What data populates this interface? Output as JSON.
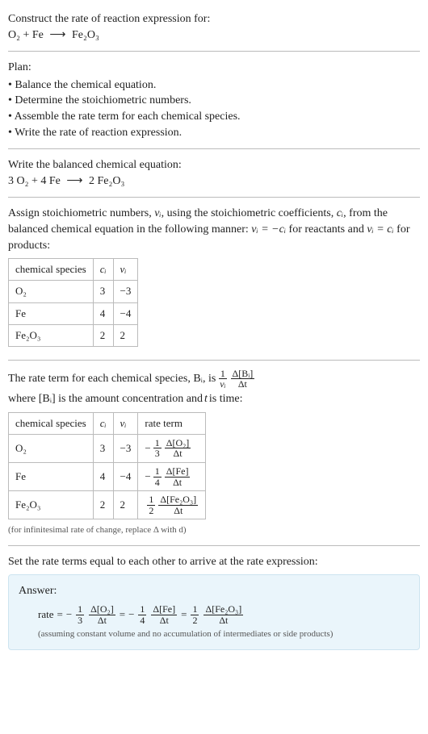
{
  "header": {
    "prompt": "Construct the rate of reaction expression for:",
    "equation_lhs": "O₂ + Fe",
    "equation_rhs": "Fe₂O₃"
  },
  "plan": {
    "title": "Plan:",
    "items": [
      "Balance the chemical equation.",
      "Determine the stoichiometric numbers.",
      "Assemble the rate term for each chemical species.",
      "Write the rate of reaction expression."
    ]
  },
  "balanced": {
    "title": "Write the balanced chemical equation:",
    "lhs": "3 O₂ + 4 Fe",
    "rhs": "2 Fe₂O₃"
  },
  "stoich": {
    "intro_a": "Assign stoichiometric numbers, ",
    "nu_i": "νᵢ",
    "intro_b": ", using the stoichiometric coefficients, ",
    "c_i": "cᵢ",
    "intro_c": ", from the balanced chemical equation in the following manner: ",
    "rel_reactants": "νᵢ = −cᵢ",
    "intro_d": " for reactants and ",
    "rel_products": "νᵢ = cᵢ",
    "intro_e": " for products:",
    "headers": {
      "species": "chemical species",
      "ci": "cᵢ",
      "nui": "νᵢ"
    },
    "rows": [
      {
        "species": "O₂",
        "ci": "3",
        "nui": "−3"
      },
      {
        "species": "Fe",
        "ci": "4",
        "nui": "−4"
      },
      {
        "species": "Fe₂O₃",
        "ci": "2",
        "nui": "2"
      }
    ]
  },
  "rateterm": {
    "intro_a": "The rate term for each chemical species, Bᵢ, is ",
    "frac1_num": "1",
    "frac1_den": "νᵢ",
    "frac2_num": "Δ[Bᵢ]",
    "frac2_den": "Δt",
    "intro_b": " where [Bᵢ] is the amount concentration and ",
    "t": "t",
    "intro_c": " is time:",
    "headers": {
      "species": "chemical species",
      "ci": "cᵢ",
      "nui": "νᵢ",
      "rate": "rate term"
    },
    "rows": [
      {
        "species": "O₂",
        "ci": "3",
        "nui": "−3",
        "sign": "−",
        "coef_num": "1",
        "coef_den": "3",
        "d_num": "Δ[O₂]",
        "d_den": "Δt"
      },
      {
        "species": "Fe",
        "ci": "4",
        "nui": "−4",
        "sign": "−",
        "coef_num": "1",
        "coef_den": "4",
        "d_num": "Δ[Fe]",
        "d_den": "Δt"
      },
      {
        "species": "Fe₂O₃",
        "ci": "2",
        "nui": "2",
        "sign": "",
        "coef_num": "1",
        "coef_den": "2",
        "d_num": "Δ[Fe₂O₃]",
        "d_den": "Δt"
      }
    ],
    "note": "(for infinitesimal rate of change, replace Δ with d)"
  },
  "final": {
    "title": "Set the rate terms equal to each other to arrive at the rate expression:"
  },
  "answer": {
    "label": "Answer:",
    "rate_word": "rate",
    "eq": "=",
    "minus": "−",
    "t1": {
      "cnum": "1",
      "cden": "3",
      "dnum": "Δ[O₂]",
      "dden": "Δt"
    },
    "t2": {
      "cnum": "1",
      "cden": "4",
      "dnum": "Δ[Fe]",
      "dden": "Δt"
    },
    "t3": {
      "cnum": "1",
      "cden": "2",
      "dnum": "Δ[Fe₂O₃]",
      "dden": "Δt"
    },
    "note": "(assuming constant volume and no accumulation of intermediates or side products)"
  },
  "chart_data": {
    "type": "table",
    "tables": [
      {
        "title": "Stoichiometric numbers",
        "columns": [
          "chemical species",
          "c_i",
          "nu_i"
        ],
        "rows": [
          [
            "O2",
            3,
            -3
          ],
          [
            "Fe",
            4,
            -4
          ],
          [
            "Fe2O3",
            2,
            2
          ]
        ]
      },
      {
        "title": "Rate terms",
        "columns": [
          "chemical species",
          "c_i",
          "nu_i",
          "rate term"
        ],
        "rows": [
          [
            "O2",
            3,
            -3,
            "-(1/3) d[O2]/dt"
          ],
          [
            "Fe",
            4,
            -4,
            "-(1/4) d[Fe]/dt"
          ],
          [
            "Fe2O3",
            2,
            2,
            "(1/2) d[Fe2O3]/dt"
          ]
        ]
      }
    ],
    "balanced_equation": "3 O2 + 4 Fe -> 2 Fe2O3",
    "rate_expression": "rate = -(1/3) d[O2]/dt = -(1/4) d[Fe]/dt = (1/2) d[Fe2O3]/dt"
  }
}
